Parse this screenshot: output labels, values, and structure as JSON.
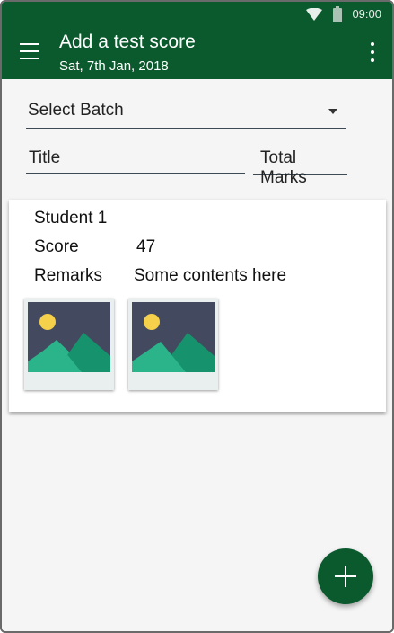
{
  "status_bar": {
    "time": "09:00",
    "icons": [
      "wifi-icon",
      "battery-icon"
    ]
  },
  "app_bar": {
    "title": "Add a test score",
    "subtitle": "Sat, 7th Jan, 2018",
    "icons": [
      "menu-icon",
      "overflow-menu-icon"
    ]
  },
  "form": {
    "batch_select": {
      "value": "Select Batch",
      "icon": "dropdown-caret-icon"
    },
    "title_field": {
      "value": "Title"
    },
    "total_marks_field": {
      "value": "Total Marks"
    }
  },
  "student_card": {
    "name": "Student 1",
    "score_label": "Score",
    "score_value": "47",
    "remarks_label": "Remarks",
    "remarks_value": "Some contents here",
    "attachments": [
      "image-placeholder-icon",
      "image-placeholder-icon"
    ]
  },
  "fab": {
    "icon": "plus-icon"
  },
  "colors": {
    "primary": "#0b5a2d",
    "background": "#f5f5f5",
    "card": "#ffffff",
    "placeholder_bg": "#434a60",
    "placeholder_sun": "#f5d04a",
    "placeholder_hill_light": "#2bb489",
    "placeholder_hill_dark": "#16936c"
  }
}
